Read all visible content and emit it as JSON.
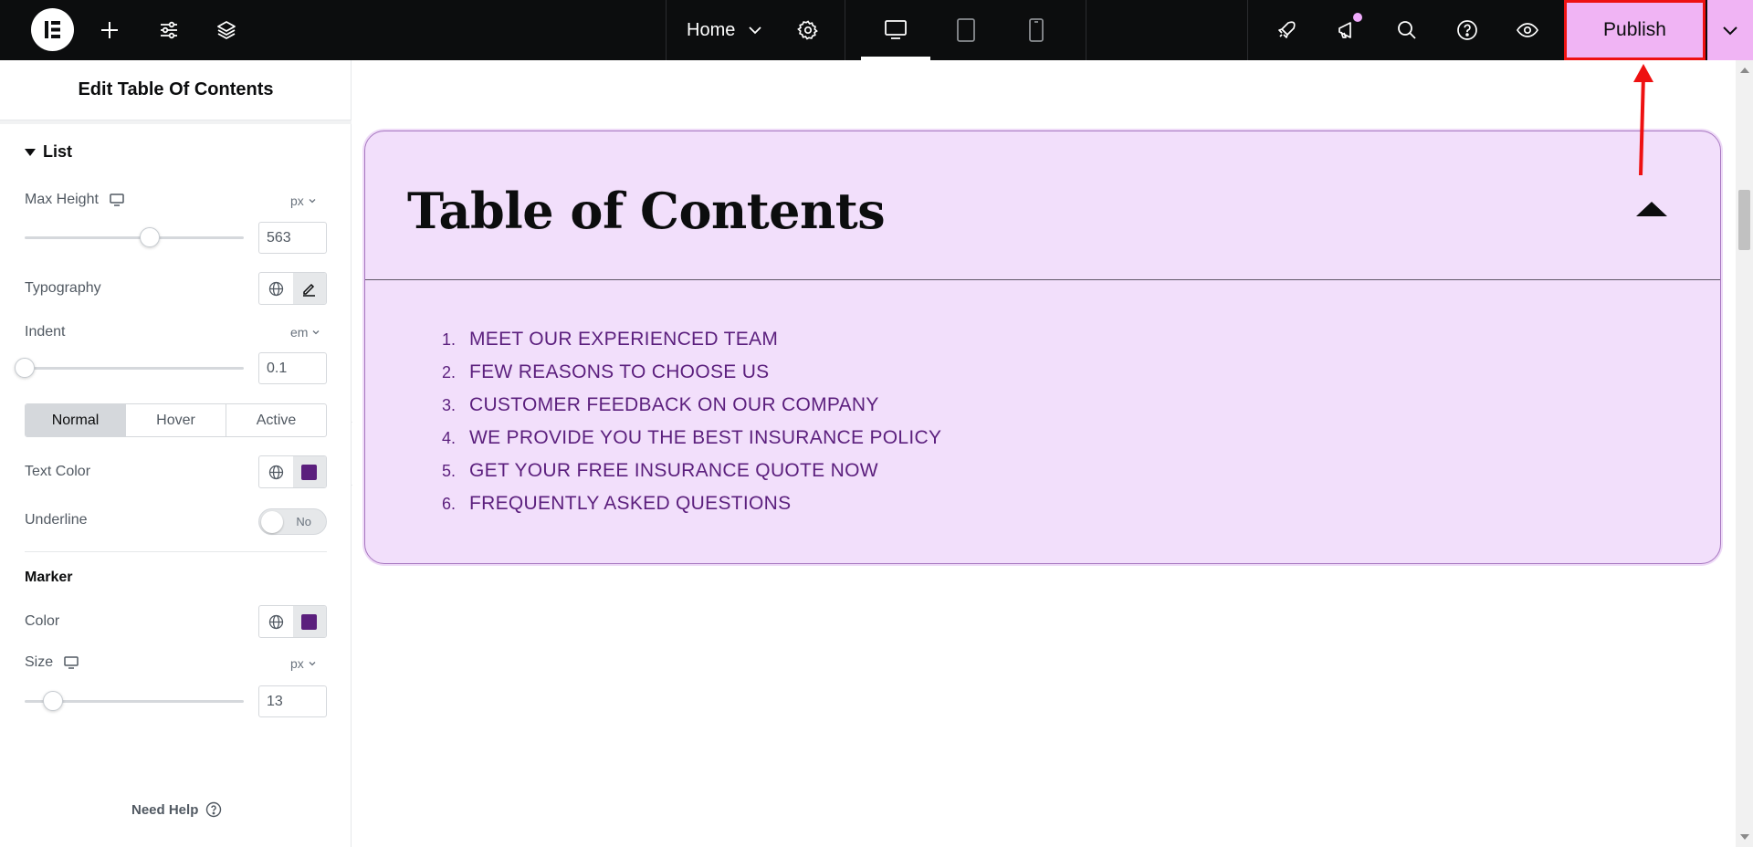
{
  "topbar": {
    "home_label": "Home",
    "publish_label": "Publish",
    "icons": [
      "elementor-logo-icon",
      "add-icon",
      "site-settings-icon",
      "layers-icon",
      "chevron-down-icon",
      "gear-icon",
      "desktop-icon",
      "tablet-icon",
      "mobile-icon",
      "rocket-icon",
      "megaphone-icon",
      "search-icon",
      "help-icon",
      "eye-icon",
      "chevron-down-icon"
    ],
    "notification_dot_color": "#f0abfc",
    "publish_bg": "#f0b4f4",
    "highlight_color": "#ee1111"
  },
  "panel": {
    "title": "Edit Table Of Contents",
    "section": "List",
    "max_height": {
      "label": "Max Height",
      "unit": "px",
      "value": "563",
      "fraction": 0.57
    },
    "typography": {
      "label": "Typography"
    },
    "indent": {
      "label": "Indent",
      "unit": "em",
      "value": "0.1",
      "fraction": 0.0
    },
    "state_tabs": [
      "Normal",
      "Hover",
      "Active"
    ],
    "text_color": {
      "label": "Text Color",
      "color": "#5b1f7d"
    },
    "underline": {
      "label": "Underline",
      "value": "No"
    },
    "marker": {
      "heading": "Marker",
      "color_label": "Color",
      "color": "#5b1f7d",
      "size_label": "Size",
      "size_unit": "px",
      "size_value": "13",
      "size_fraction": 0.13
    },
    "need_help": "Need Help"
  },
  "toc": {
    "title": "Table of Contents",
    "items": [
      {
        "num": "1.",
        "text": "MEET OUR EXPERIENCED TEAM"
      },
      {
        "num": "2.",
        "text": "FEW REASONS TO CHOOSE US"
      },
      {
        "num": "3.",
        "text": "CUSTOMER FEEDBACK ON OUR COMPANY"
      },
      {
        "num": "4.",
        "text": "WE PROVIDE YOU THE BEST INSURANCE POLICY"
      },
      {
        "num": "5.",
        "text": "GET YOUR FREE INSURANCE QUOTE NOW"
      },
      {
        "num": "6.",
        "text": "FREQUENTLY ASKED QUESTIONS"
      }
    ],
    "bg_color": "#f2dffb",
    "text_color": "#5b1f7d"
  }
}
